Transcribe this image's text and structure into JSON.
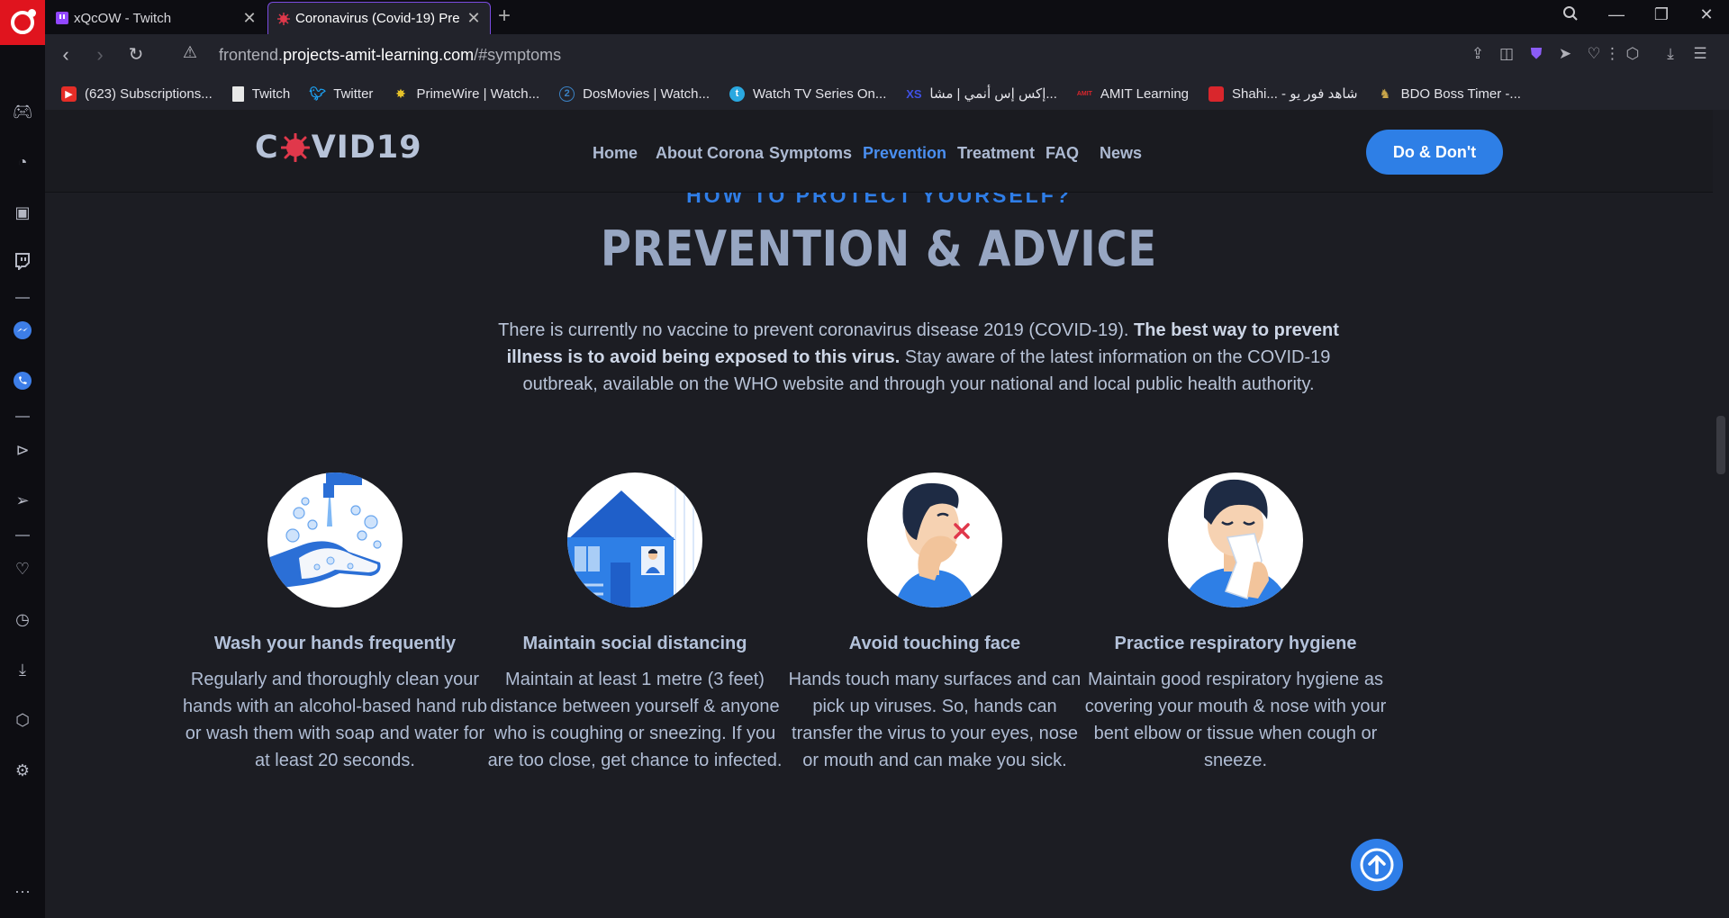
{
  "browser": {
    "tabs": [
      {
        "title": "xQcOW - Twitch",
        "favicon": "twitch-icon"
      },
      {
        "title": "Coronavirus (Covid-19) Pre",
        "favicon": "virus-icon",
        "active": true
      }
    ],
    "url": {
      "prefix": "frontend.",
      "domain": "projects-amit-learning.com",
      "path": "/#symptoms"
    },
    "bookmarks": [
      {
        "label": "(623) Subscriptions...",
        "icon": "youtube-icon",
        "color": "#e52d27"
      },
      {
        "label": "Twitch",
        "icon": "page-icon",
        "color": "#ffffff"
      },
      {
        "label": "Twitter",
        "icon": "twitter-icon",
        "color": "#1da1f2"
      },
      {
        "label": "PrimeWire | Watch...",
        "icon": "primewire-icon",
        "color": "#e6c229"
      },
      {
        "label": "DosMovies | Watch...",
        "icon": "dosmovies-icon",
        "color": "#3b82c4"
      },
      {
        "label": "Watch TV Series On...",
        "icon": "tv-icon",
        "color": "#2aa8e0"
      },
      {
        "label": "إكس إس أنمي | مشا...",
        "icon": "xs-icon",
        "color": "#3f51e6"
      },
      {
        "label": "AMIT Learning",
        "icon": "amit-icon",
        "color": "#d9262c"
      },
      {
        "label": "Shahi... - شاهد فور يو",
        "icon": "shahid-icon",
        "color": "#d9262c"
      },
      {
        "label": "BDO Boss Timer -...",
        "icon": "bdo-icon",
        "color": "#caa64a"
      }
    ]
  },
  "site": {
    "logo": {
      "before": "C",
      "after": "VID19"
    },
    "nav": [
      "Home",
      "About Corona",
      "Symptoms",
      "Prevention",
      "Treatment",
      "FAQ",
      "News"
    ],
    "active_nav": "Prevention",
    "cta": "Do & Don't"
  },
  "section": {
    "eyebrow": "HOW TO PROTECT YOURSELF?",
    "title": "PREVENTION & ADVICE",
    "intro_1": "There is currently no vaccine to prevent coronavirus disease 2019 (COVID-19). ",
    "intro_bold": "The best way to prevent illness is to avoid being exposed to this virus.",
    "intro_2": " Stay aware of the latest information on the COVID-19 outbreak, available on the WHO website and through your national and local public health authority."
  },
  "cards": [
    {
      "title": "Wash your hands frequently",
      "text": "Regularly and thoroughly clean your hands with an alcohol-based hand rub or wash them with soap and water for at least 20 seconds.",
      "icon": "handwashing-illustration"
    },
    {
      "title": "Maintain social distancing",
      "text": "Maintain at least 1 metre (3 feet) distance between yourself & anyone who is coughing or sneezing. If you are too close, get chance to infected.",
      "icon": "house-illustration"
    },
    {
      "title": "Avoid touching face",
      "text": "Hands touch many surfaces and can pick up viruses. So, hands can transfer the virus to your eyes, nose or mouth and can make you sick.",
      "icon": "no-face-touch-illustration"
    },
    {
      "title": "Practice respiratory hygiene",
      "text": "Maintain good respiratory hygiene as covering your mouth & nose with your bent elbow or tissue when cough or sneeze.",
      "icon": "sneeze-tissue-illustration"
    }
  ],
  "colors": {
    "accent": "#2f7ee8",
    "brand_red": "#e0141e",
    "heading": "#97a6c2"
  }
}
